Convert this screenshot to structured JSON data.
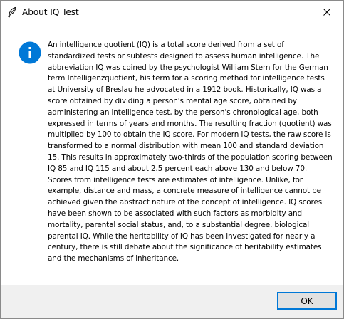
{
  "window": {
    "title": "About IQ Test",
    "title_icon": "feather-icon",
    "close_icon": "close-icon"
  },
  "dialog": {
    "icon": "info-icon",
    "message": "An intelligence quotient (IQ) is a total score derived from a set of standardized tests or subtests designed to assess human intelligence. The abbreviation IQ was coined by the psychologist William Stern for the German term Intelligenzquotient, his term for a scoring method for intelligence tests at University of Breslau he advocated in a 1912 book. Historically, IQ was a score obtained by dividing a person's mental age score, obtained by administering an intelligence test, by the person's chronological age, both expressed in terms of years and months. The resulting fraction (quotient) was multiplied by 100 to obtain the IQ score. For modern IQ tests, the raw score is transformed to a normal distribution with mean 100 and standard deviation 15. This results in approximately two-thirds of the population scoring between IQ 85 and IQ 115 and about 2.5 percent each above 130 and below 70. Scores from intelligence tests are estimates of intelligence. Unlike, for example, distance and mass, a concrete measure of intelligence cannot be achieved given the abstract nature of the concept of intelligence. IQ scores have been shown to be associated with such factors as morbidity and mortality, parental social status, and, to a substantial degree, biological parental IQ. While the heritability of IQ has been investigated for nearly a century, there is still debate about the significance of heritability estimates and the mechanisms of inheritance."
  },
  "buttons": {
    "ok_label": "OK"
  },
  "colors": {
    "info_blue": "#0078d7",
    "footer_bg": "#f0f0f0",
    "button_border": "#0078d7"
  }
}
